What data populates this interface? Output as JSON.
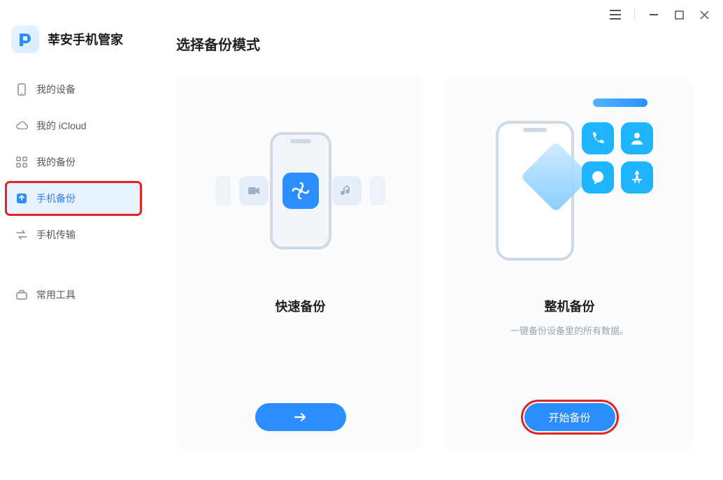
{
  "brand": {
    "title": "莘安手机管家"
  },
  "window": {
    "menu": "≡",
    "minimize": "—",
    "maximize": "□",
    "close": "✕"
  },
  "sidebar": {
    "items": [
      {
        "id": "my-device",
        "label": "我的设备",
        "icon": "phone-icon"
      },
      {
        "id": "my-icloud",
        "label": "我的 iCloud",
        "icon": "cloud-icon"
      },
      {
        "id": "my-backup",
        "label": "我的备份",
        "icon": "grid-icon"
      },
      {
        "id": "phone-backup",
        "label": "手机备份",
        "icon": "backup-icon"
      },
      {
        "id": "phone-transfer",
        "label": "手机传输",
        "icon": "transfer-icon"
      },
      {
        "id": "tools",
        "label": "常用工具",
        "icon": "toolbox-icon"
      }
    ],
    "active_index": 3
  },
  "page": {
    "title": "选择备份模式"
  },
  "cards": [
    {
      "id": "quick-backup",
      "title": "快速备份",
      "desc": "",
      "button_label": "→",
      "button_kind": "arrow"
    },
    {
      "id": "full-backup",
      "title": "整机备份",
      "desc": "一键备份设备里的所有数据。",
      "button_label": "开始备份",
      "button_kind": "text"
    }
  ],
  "colors": {
    "accent": "#2a8eff",
    "highlight": "#e02424",
    "card_bg": "#fafcfe",
    "sidebar_active": "#e8f2ff"
  }
}
